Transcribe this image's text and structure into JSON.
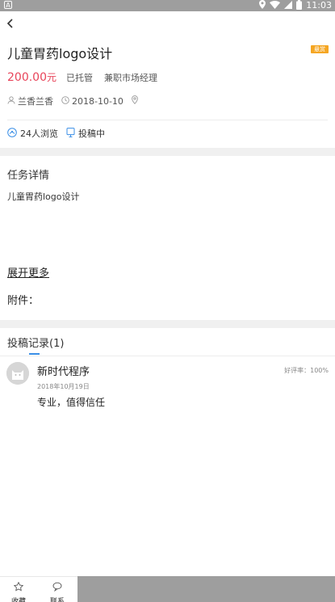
{
  "status_bar": {
    "time": "11:03"
  },
  "task": {
    "title": "儿童胃药logo设计",
    "badge": "悬赏",
    "price": "200.00",
    "price_unit": "元",
    "tags": [
      "已托管",
      "兼职市场经理"
    ],
    "user": "兰香兰香",
    "date": "2018-10-10",
    "views": "24人浏览",
    "status": "投稿中"
  },
  "details": {
    "heading": "任务详情",
    "text": "儿童胃药logo设计",
    "expand": "展开更多",
    "attachment": "附件："
  },
  "submissions": {
    "heading": "投稿记录(1)",
    "records": [
      {
        "name": "新时代程序",
        "rate": "好评率：100%",
        "date": "2018年10月19日",
        "comment": "专业，值得信任"
      }
    ]
  },
  "bottom_bar": {
    "favorite": "收藏",
    "contact": "联系"
  },
  "colors": {
    "price": "#e8445a",
    "badge": "#f5a623",
    "accent": "#3a8ee6",
    "status_bar": "#9e9e9e"
  }
}
